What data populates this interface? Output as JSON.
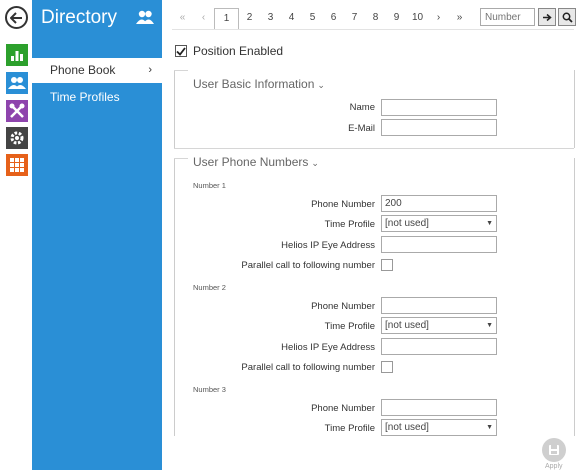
{
  "sidebar": {
    "title": "Directory",
    "items": [
      {
        "label": "Phone Book",
        "chevron": "›"
      },
      {
        "label": "Time Profiles"
      }
    ]
  },
  "pager": {
    "first": "«",
    "prev": "‹",
    "pages": [
      "1",
      "2",
      "3",
      "4",
      "5",
      "6",
      "7",
      "8",
      "9",
      "10"
    ],
    "next": "›",
    "last": "»",
    "active_page": "1",
    "number_placeholder": "Number"
  },
  "position_enabled": {
    "label": "Position Enabled",
    "checked": true
  },
  "basic_info": {
    "title": "User Basic Information",
    "caret": "⌄",
    "name_label": "Name",
    "name_value": "",
    "email_label": "E-Mail",
    "email_value": ""
  },
  "phone_numbers": {
    "title": "User Phone Numbers",
    "caret": "⌄",
    "numbers": [
      {
        "heading": "Number 1",
        "phone_label": "Phone Number",
        "phone_value": "200",
        "profile_label": "Time Profile",
        "profile_value": "[not used]",
        "ip_eye_label": "Helios IP Eye Address",
        "ip_eye_value": "",
        "parallel_label": "Parallel call to following number"
      },
      {
        "heading": "Number 2",
        "phone_label": "Phone Number",
        "phone_value": "",
        "profile_label": "Time Profile",
        "profile_value": "[not used]",
        "ip_eye_label": "Helios IP Eye Address",
        "ip_eye_value": "",
        "parallel_label": "Parallel call to following number"
      },
      {
        "heading": "Number 3",
        "phone_label": "Phone Number",
        "phone_value": "",
        "profile_label": "Time Profile",
        "profile_value": "[not used]"
      }
    ]
  },
  "apply": {
    "label": "Apply"
  },
  "icons": {
    "back": "back-arrow-icon",
    "status": "bar-chart-icon",
    "directory": "people-icon",
    "hardware": "tools-icon",
    "services": "gear-icon",
    "system": "grid-icon"
  },
  "colors": {
    "sidebar": "#2a8fd6",
    "status": "#2ca02c",
    "directory": "#2a8fd6",
    "hardware": "#8e44ad",
    "services": "#444444",
    "system": "#e6611a"
  }
}
